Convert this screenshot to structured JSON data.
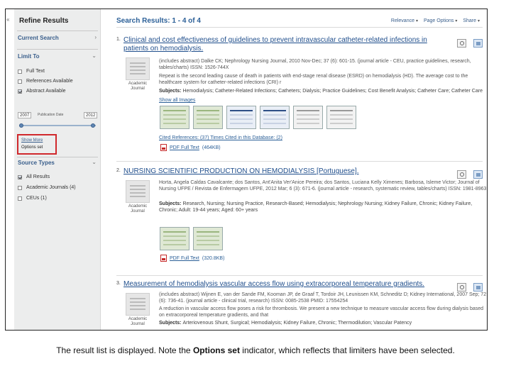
{
  "sidebar": {
    "collapse_glyph": "«",
    "title": "Refine Results",
    "current_search": "Current Search",
    "limit_to": "Limit To",
    "limiters": [
      {
        "label": "Full Text",
        "checked": false
      },
      {
        "label": "References Available",
        "checked": false
      },
      {
        "label": "Abstract Available",
        "checked": true
      }
    ],
    "date_from": "2007",
    "date_to": "2012",
    "date_label": "Publication Date",
    "show_more": "Show More",
    "options_set": "Options set",
    "source_types": "Source Types",
    "sources": [
      {
        "label": "All Results",
        "checked": true
      },
      {
        "label": "Academic Journals (4)",
        "checked": false
      },
      {
        "label": "CEUs (1)",
        "checked": false
      }
    ],
    "chevron_glyph": "›",
    "expand_glyph": "⌄"
  },
  "header": {
    "results_title": "Search Results: 1 - 4 of 4",
    "sort_relevance": "Relevance",
    "page_options": "Page Options",
    "share": "Share",
    "caret": "▾"
  },
  "results": [
    {
      "num": "1.",
      "title": "Clinical and cost effectiveness of guidelines to prevent intravascular catheter-related infections in patients on hemodialysis.",
      "thumb_label": "Academic Journal",
      "meta": "(includes abstract) Dalke CK; Nephrology Nursing Journal, 2010 Nov-Dec; 37 (6): 601-15. (journal article - CEU, practice guidelines, research, tables/charts) ISSN: 1526-744X",
      "abstract": "Repeat is the second leading cause of death in patients with end-stage renal disease (ESRD) on hemodialysis (HD). The average cost to the healthcare system for catheter-related infections (CRI) r",
      "subjects": "Hemodialysis; Catheter-Related Infections; Catheters; Dialysis; Practice Guidelines; Cost Benefit Analysis; Catheter Care; Catheter Care",
      "show_images": "Show all Images",
      "cited": "Cited References: (37) Times Cited in this Database: (2)",
      "pdf": "PDF Full Text",
      "pdf_size": "(464KB)"
    },
    {
      "num": "2.",
      "title": "NURSING SCIENTIFIC PRODUCTION ON HEMODIALYSIS [Portuguese].",
      "thumb_label": "Academic Journal",
      "meta": "Horta, Angela Caldas Cavalcante; dos Santos, Ant'Anita Ver'Anice Pereira; dos Santos, Luciana Kelly Ximenes; Barbosa, Isleme Victor; Journal of Nursing UFPE / Revista de Enfermagem UFPE, 2012 Mar; 6 (3): 671-6. (journal article - research, systematic review, tables/charts) ISSN: 1981-8963",
      "subjects": "Research, Nursing; Nursing Practice, Research-Based; Hemodialysis; Nephrology Nursing; Kidney Failure, Chronic; Kidney Failure, Chronic; Adult: 19-44 years; Aged: 60+ years",
      "pdf": "PDF Full Text",
      "pdf_size": "(320.8KB)"
    },
    {
      "num": "3.",
      "title": "Measurement of hemodialysis vascular access flow using extracorporeal temperature gradients.",
      "thumb_label": "Academic Journal",
      "meta": "(includes abstract) Wijnen E, van der Sande FM, Kooman JP, de Graaf T, Tordoir JH, Leunissen KM, Schneditz D; Kidney International, 2007 Sep; 72 (6): 736-41. (journal article - clinical trial, research) ISSN: 0085-2538 PMID: 17554254",
      "abstract": "A reduction in vascular access flow poses a risk for thrombosis. We present a new technique to measure vascular access flow during dialysis based on extracorporeal temperature gradients, and that",
      "subjects": "Arteriovenous Shunt, Surgical; Hemodialysis; Kidney Failure, Chronic; Thermodilution; Vascular Patency"
    }
  ],
  "caption": {
    "before": "The result list is displayed. Note the ",
    "bold": "Options set",
    "after": " indicator, which reflects that limiters have been selected."
  },
  "colors": {
    "link": "#1f4e8c",
    "highlight_box": "#d0282c",
    "sidebar_bg": "#eceded"
  }
}
